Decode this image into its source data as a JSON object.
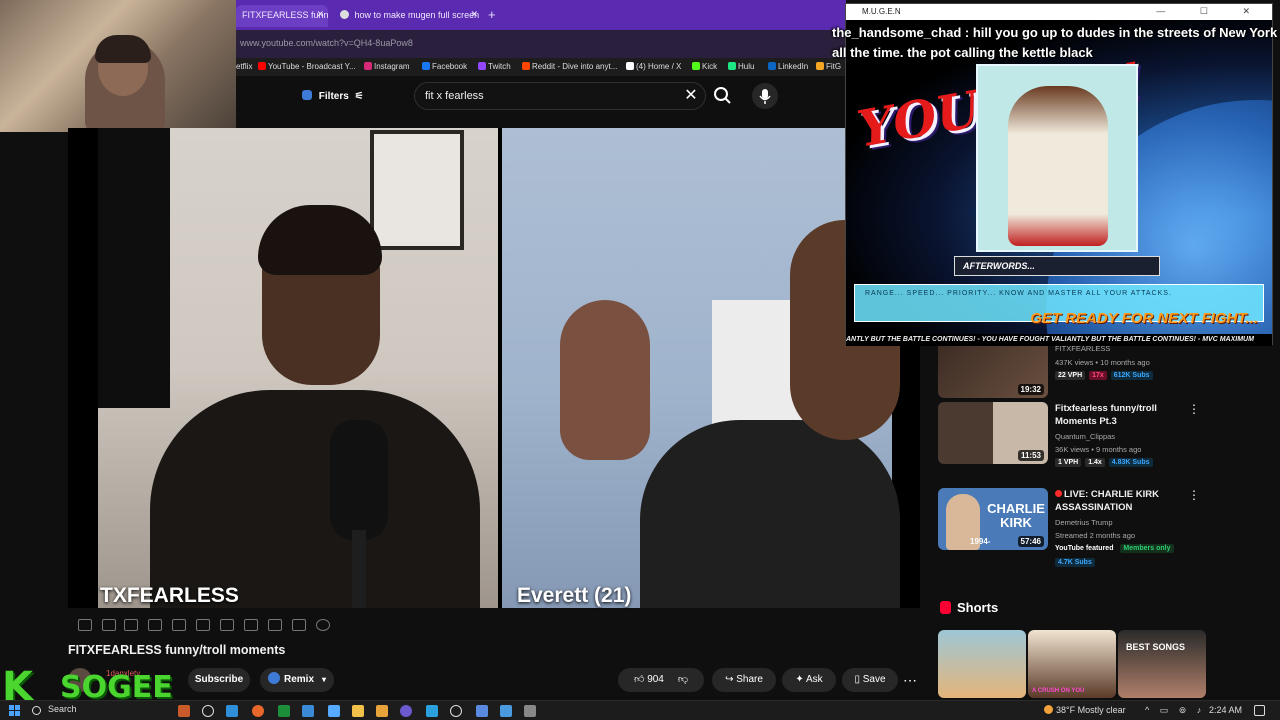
{
  "browser": {
    "tabs": [
      {
        "label": "FITXFEARLESS funny/"
      },
      {
        "label": "how to make mugen full screen"
      }
    ],
    "new_tab": "+",
    "url": "www.youtube.com/watch?v=QH4-8uaPow8",
    "bookmarks": [
      {
        "label": "etflix",
        "color": "#e50914"
      },
      {
        "label": "YouTube - Broadcast Y...",
        "color": "#ff0000"
      },
      {
        "label": "Instagram",
        "color": "#d62976"
      },
      {
        "label": "Facebook",
        "color": "#1877f2"
      },
      {
        "label": "Twitch",
        "color": "#9146ff"
      },
      {
        "label": "Reddit - Dive into anyt...",
        "color": "#ff4500"
      },
      {
        "label": "(4) Home / X",
        "color": "#ffffff"
      },
      {
        "label": "Kick",
        "color": "#53fc18"
      },
      {
        "label": "Hulu",
        "color": "#1ce783"
      },
      {
        "label": "LinkedIn",
        "color": "#0a66c2"
      },
      {
        "label": "FitG",
        "color": "#f5a623"
      }
    ]
  },
  "youtube": {
    "filters_label": "Filters",
    "search_value": "fit x fearless",
    "video": {
      "left_label": "TXFEARLESS",
      "right_label": "Everett (21)",
      "title": "FITXFEARLESS funny/troll moments",
      "channel_name": "1danxlety",
      "subscribe_label": "Subscribe",
      "remix_label": "Remix",
      "likes": "904",
      "share_label": "Share",
      "ask_label": "Ask",
      "save_label": "Save",
      "more": "⋯"
    },
    "recommendations": [
      {
        "title": "",
        "channel": "FITXFEARLESS",
        "meta": "437K views • 10 months ago",
        "duration": "19:32",
        "stats": [
          {
            "text": "22 VPH",
            "bg": "#2a2a2a",
            "fg": "#ffffff"
          },
          {
            "text": "17x",
            "bg": "#6a0f2a",
            "fg": "#ff4a7a"
          },
          {
            "text": "612K Subs",
            "bg": "#0f2a3a",
            "fg": "#3aa8ff"
          }
        ]
      },
      {
        "title": "Fitxfearless funny/troll Moments Pt.3",
        "channel": "Quantum_Clippas",
        "meta": "36K views • 9 months ago",
        "duration": "11:53",
        "stats": [
          {
            "text": "1 VPH",
            "bg": "#2a2a2a",
            "fg": "#ffffff"
          },
          {
            "text": "1.4x",
            "bg": "#2a2a2a",
            "fg": "#ffffff"
          },
          {
            "text": "4.83K Subs",
            "bg": "#0f2a3a",
            "fg": "#3aa8ff"
          }
        ]
      },
      {
        "title": "LIVE: CHARLIE KIRK ASSASSINATION",
        "channel": "Demetrius Trump",
        "meta": "Streamed 2 months ago",
        "duration": "57:46",
        "thumb_text": "CHARLIE KIRK",
        "thumb_years": "1994-",
        "featured": "YouTube featured",
        "members": "Members only",
        "stats": [
          {
            "text": "4.7K Subs",
            "bg": "#0f2a3a",
            "fg": "#3aa8ff"
          }
        ]
      }
    ],
    "shorts_label": "Shorts",
    "shorts": [
      {
        "label": ""
      },
      {
        "label": "A CRUSH ON YOU"
      },
      {
        "label": "BEST SONGS"
      }
    ]
  },
  "mugen": {
    "window_title": "M.U.G.E.N",
    "window_controls": "—  ☐  ✕",
    "you_win": "YOU WIN!",
    "afterwords_label": "AFTERWORDS...",
    "afterwords_text": "RANGE... SPEED... PRIORITY... KNOW AND MASTER ALL YOUR ATTACKS.",
    "get_ready": "GET READY FOR NEXT FIGHT...",
    "scroller": "ANTLY BUT THE BATTLE CONTINUES! - YOU HAVE FOUGHT VALIANTLY BUT THE BATTLE CONTINUES! - MVC MAXIMUM"
  },
  "chat_overlay": "the_handsome_chad : hill you go up to dudes in the streets of New York all the time. the pot calling the kettle black",
  "stream_brand": {
    "letter": "K",
    "name": "SOGEE"
  },
  "taskbar": {
    "search_label": "Search",
    "weather": "38°F  Mostly clear",
    "clock": "2:24 AM",
    "tray": "^ ▭ ⊚ ♪"
  },
  "colors": {
    "tabbar": "#5a2bb0",
    "brand_green": "#4ad62f",
    "yt_red": "#ff0033"
  }
}
